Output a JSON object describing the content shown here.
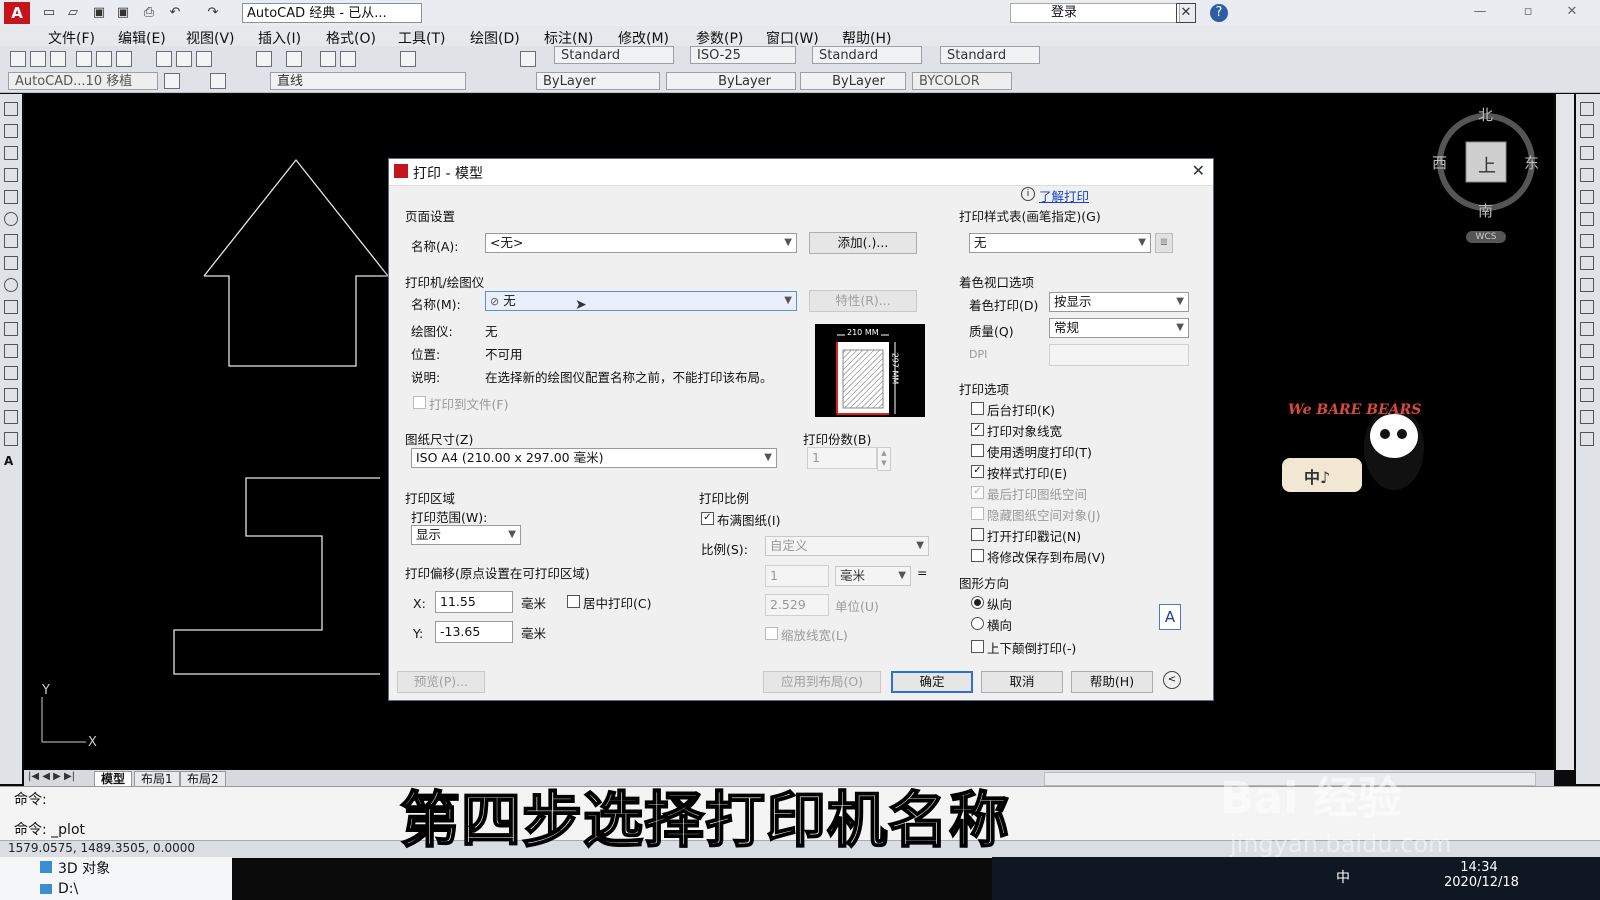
{
  "titlebar": {
    "workspace": "AutoCAD 经典 - 已从...",
    "login": "登录"
  },
  "menu": [
    "文件(F)",
    "编辑(E)",
    "视图(V)",
    "插入(I)",
    "格式(O)",
    "工具(T)",
    "绘图(D)",
    "标注(N)",
    "修改(M)",
    "参数(P)",
    "窗口(W)",
    "帮助(H)"
  ],
  "toolbar": {
    "text_style": "Standard",
    "dim_style": "ISO-25",
    "table_style": "Standard",
    "multileader_style": "Standard",
    "layer_state": "AutoCAD...10 移植",
    "layer": "直线",
    "color": "ByLayer",
    "linetype": "ByLayer",
    "lineweight": "ByLayer",
    "plotstyle": "BYCOLOR"
  },
  "compass": {
    "north": "北",
    "south": "南",
    "east": "东",
    "west": "西",
    "top": "上",
    "wcs": "WCS"
  },
  "tabs": [
    "模型",
    "布局1",
    "布局2"
  ],
  "command": {
    "line1": "命令:",
    "line2": "命令: _plot"
  },
  "coords": "1579.0575, 1489.3505, 0.0000",
  "explorer": {
    "item1": "3D 对象",
    "item2": "D:\\"
  },
  "tray": {
    "time": "14:34",
    "date": "2020/12/18",
    "ime": "中"
  },
  "dialog": {
    "title": "打印 - 模型",
    "learn_link": "了解打印",
    "page_setup": {
      "section": "页面设置",
      "name_label": "名称(A):",
      "name_value": "<无>",
      "add_button": "添加(.)..."
    },
    "printer": {
      "section": "打印机/绘图仪",
      "name_label": "名称(M):",
      "name_value": "无",
      "properties_button": "特性(R)...",
      "plotter_label": "绘图仪:",
      "plotter_value": "无",
      "location_label": "位置:",
      "location_value": "不可用",
      "desc_label": "说明:",
      "desc_value": "在选择新的绘图仪配置名称之前，不能打印该布局。",
      "plot_to_file": "打印到文件(F)",
      "preview_width": "210 MM",
      "preview_height": "297 MM"
    },
    "paper_size": {
      "section": "图纸尺寸(Z)",
      "value": "ISO A4 (210.00 x 297.00 毫米)"
    },
    "copies": {
      "section": "打印份数(B)",
      "value": "1"
    },
    "plot_area": {
      "section": "打印区域",
      "range_label": "打印范围(W):",
      "range_value": "显示"
    },
    "plot_scale": {
      "section": "打印比例",
      "fit_paper": "布满图纸(I)",
      "scale_label": "比例(S):",
      "scale_value": "自定义",
      "value1": "1",
      "unit1": "毫米",
      "value2": "2.529",
      "unit2": "单位(U)",
      "scale_lineweights": "缩放线宽(L)"
    },
    "plot_offset": {
      "section": "打印偏移(原点设置在可打印区域)",
      "x_label": "X:",
      "x_value": "11.55",
      "x_unit": "毫米",
      "y_label": "Y:",
      "y_value": "-13.65",
      "y_unit": "毫米",
      "center": "居中打印(C)"
    },
    "plot_style_table": {
      "section": "打印样式表(画笔指定)(G)",
      "value": "无"
    },
    "shaded_viewport": {
      "section": "着色视口选项",
      "shade_label": "着色打印(D)",
      "shade_value": "按显示",
      "quality_label": "质量(Q)",
      "quality_value": "常规",
      "dpi_label": "DPI"
    },
    "plot_options": {
      "section": "打印选项",
      "items": [
        {
          "label": "后台打印(K)",
          "checked": false,
          "enabled": true
        },
        {
          "label": "打印对象线宽",
          "checked": true,
          "enabled": true
        },
        {
          "label": "使用透明度打印(T)",
          "checked": false,
          "enabled": true
        },
        {
          "label": "按样式打印(E)",
          "checked": true,
          "enabled": true
        },
        {
          "label": "最后打印图纸空间",
          "checked": true,
          "enabled": false
        },
        {
          "label": "隐藏图纸空间对象(J)",
          "checked": false,
          "enabled": false
        },
        {
          "label": "打开打印戳记(N)",
          "checked": false,
          "enabled": true
        },
        {
          "label": "将修改保存到布局(V)",
          "checked": false,
          "enabled": true
        }
      ]
    },
    "orientation": {
      "section": "图形方向",
      "portrait": "纵向",
      "landscape": "横向",
      "upside_down": "上下颠倒打印(-)",
      "selected": "portrait",
      "icon_letter": "A"
    },
    "buttons": {
      "preview": "预览(P)...",
      "apply": "应用到布局(O)",
      "ok": "确定",
      "cancel": "取消",
      "help": "帮助(H)"
    }
  },
  "sticker": {
    "text1": "We BARE BEARS",
    "text2": "中♪"
  },
  "subtitle": "第四步选择打印机名称",
  "watermark": {
    "brand": "Bai 经验",
    "url": "jingyan.baidu.com"
  }
}
